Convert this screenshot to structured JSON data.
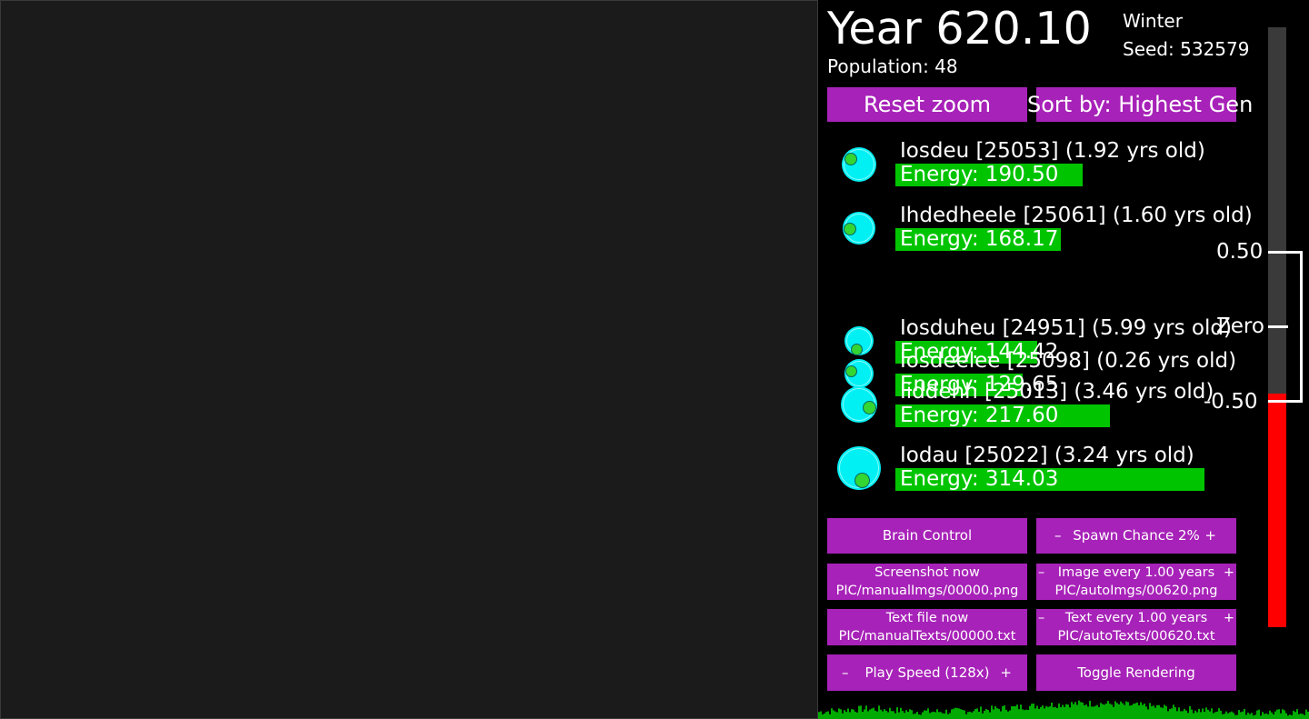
{
  "header": {
    "title": "Year 620.10",
    "population": "Population: 48",
    "season": "Winter",
    "seed": "Seed: 532579"
  },
  "top_buttons": {
    "reset_zoom": "Reset zoom",
    "sort_by": "Sort by: Highest Gen"
  },
  "creatures": [
    {
      "name": "Iosdeu [25053] (1.92 yrs old)",
      "energy": "Energy: 190.50",
      "energy_value": 190.5
    },
    {
      "name": "Ihdedheele [25061] (1.60 yrs old)",
      "energy": "Energy: 168.17",
      "energy_value": 168.17
    },
    {
      "name": "Iosduheu [24951] (5.99 yrs old)",
      "energy": "Energy: 144.42",
      "energy_value": 144.42
    },
    {
      "name": "Iosdeelee [25098] (0.26 yrs old)",
      "energy": "Energy: 129.65",
      "energy_value": 129.65
    },
    {
      "name": "Iiddehh [25013] (3.46 yrs old)",
      "energy": "Energy: 217.60",
      "energy_value": 217.6
    },
    {
      "name": "Iodau [25022] (3.24 yrs old)",
      "energy": "Energy: 314.03",
      "energy_value": 314.03
    }
  ],
  "controls": {
    "brain_control": "Brain Control",
    "spawn_chance": "Spawn Chance 2%",
    "minus": "–",
    "plus": "+",
    "screenshot_now": "Screenshot now",
    "screenshot_path": "PIC/manualImgs/00000.png",
    "image_every": "Image every 1.00 years",
    "image_path": "PIC/autoImgs/00620.png",
    "text_file_now": "Text file now",
    "text_file_path": "PIC/manualTexts/00000.txt",
    "text_every": "Text every 1.00 years",
    "text_path": "PIC/autoTexts/00620.txt",
    "play_speed": "Play Speed (128x)",
    "toggle_rendering": "Toggle Rendering"
  },
  "gauge": {
    "top_label": "0.50",
    "zero_label": "Zero",
    "bottom_label": "-0.50",
    "fill_fraction": 0.39,
    "fill_color": "#ff0000"
  },
  "colors": {
    "button": "#a722b8",
    "creature": "#00f0f4",
    "energy_bar": "#00c400",
    "histogram": "#00aa00"
  }
}
